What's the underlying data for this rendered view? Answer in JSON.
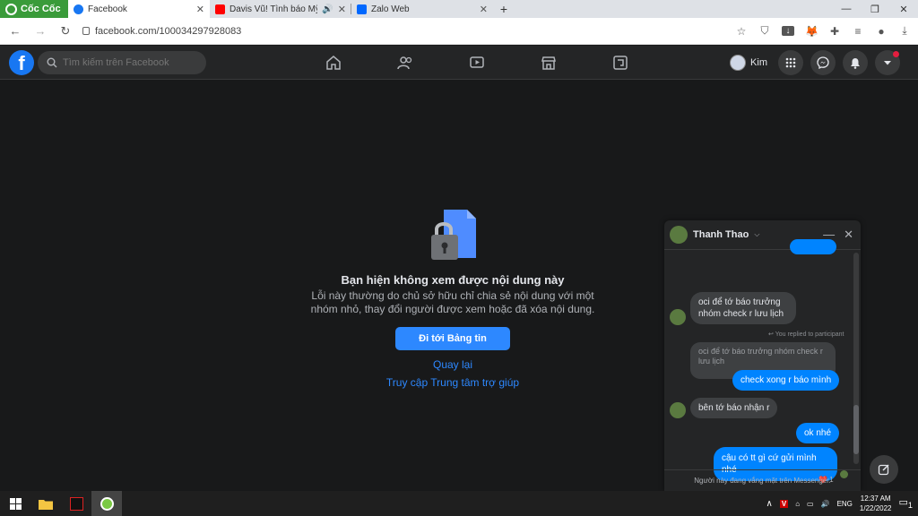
{
  "browser": {
    "brand": "Cốc Cốc",
    "tabs": [
      {
        "title": "Facebook",
        "active": true
      },
      {
        "title": "Davis Vũ! Tình báo Mỹ tại",
        "active": false
      },
      {
        "title": "Zalo Web",
        "active": false
      }
    ],
    "url": "facebook.com/100034297928083"
  },
  "fb": {
    "search_placeholder": "Tìm kiếm trên Facebook",
    "profile_name": "Kim",
    "brand_color": "#1877f2"
  },
  "error": {
    "title": "Bạn hiện không xem được nội dung này",
    "description": "Lỗi này thường do chủ sở hữu chỉ chia sẻ nội dung với một nhóm nhỏ, thay đổi người được xem hoặc đã xóa nội dung.",
    "primary_button": "Đi tới Bảng tin",
    "back_link": "Quay lại",
    "help_link": "Truy cập Trung tâm trợ giúp"
  },
  "chat": {
    "contact_name": "Thanh Thao",
    "messages": [
      {
        "from": "them",
        "text": "oci để tớ báo trưởng nhóm check r lưu lịch"
      },
      {
        "from": "me",
        "reply_note": "You replied to participant",
        "quoted": "oci để tớ báo trưởng nhóm check r lưu lịch",
        "text": "check xong r báo mình"
      },
      {
        "from": "them",
        "text": "bên tớ báo nhận r"
      },
      {
        "from": "me",
        "text": "ok nhé"
      },
      {
        "from": "me",
        "text": "cậu có tt gì cứ gửi mình nhé",
        "reaction": "❤️ 1"
      }
    ],
    "footer": "Người này đang vắng mặt trên Messenger."
  },
  "taskbar": {
    "language": "ENG",
    "time": "12:37 AM",
    "date": "1/22/2022",
    "notifications": "1"
  }
}
